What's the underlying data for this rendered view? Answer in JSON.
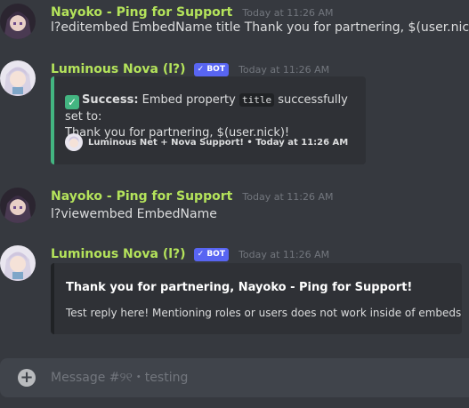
{
  "messages": [
    {
      "author": "Nayoko - Ping for Support",
      "time": "Today at 11:26 AM",
      "content": "l?editembed EmbedName title Thank you for partnering, $(user.nick)!"
    },
    {
      "author": "Luminous Nova (l?)",
      "badge": "✓ BOT",
      "time": "Today at 11:26 AM",
      "embed": {
        "success_label": "Success:",
        "text_before": "Embed property",
        "code": "title",
        "text_after": "successfully set to:",
        "line2": "Thank you for partnering, $(user.nick)!",
        "footer": "Luminous Net + Nova Support! • Today at 11:26 AM"
      }
    },
    {
      "author": "Nayoko - Ping for Support",
      "time": "Today at 11:26 AM",
      "content": "l?viewembed EmbedName"
    },
    {
      "author": "Luminous Nova (l?)",
      "badge": "✓ BOT",
      "time": "Today at 11:26 AM",
      "embed": {
        "title": "Thank you for partnering, Nayoko - Ping for Support!",
        "description": "Test reply here! Mentioning roles or users does not work inside of embeds"
      }
    }
  ],
  "composer": {
    "placeholder": "Message #୨୧・testing"
  },
  "colors": {
    "background": "#36393f",
    "author": "#b4e35b",
    "success_border": "#43b581",
    "bot_badge": "#5865f2"
  }
}
